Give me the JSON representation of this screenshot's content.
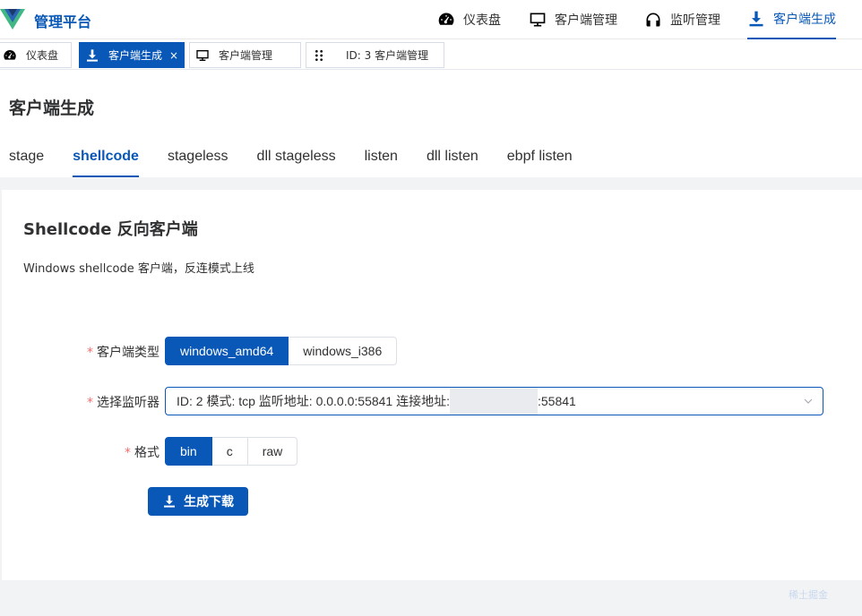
{
  "app": {
    "brand": "管理平台",
    "accent": "#0958b8"
  },
  "nav": {
    "items": [
      {
        "label": "仪表盘",
        "icon": "dashboard-icon"
      },
      {
        "label": "客户端管理",
        "icon": "monitor-icon"
      },
      {
        "label": "监听管理",
        "icon": "headphones-icon"
      },
      {
        "label": "客户端生成",
        "icon": "download-icon",
        "active": true
      }
    ]
  },
  "tabs": [
    {
      "label": "仪表盘",
      "icon": "dashboard-icon"
    },
    {
      "label": "客户端生成",
      "icon": "download-icon",
      "active": true,
      "close": "×"
    },
    {
      "label": "客户端管理",
      "icon": "monitor-icon"
    },
    {
      "label": "ID: 3 客户端管理",
      "icon": "grip-icon"
    }
  ],
  "page": {
    "title": "客户端生成",
    "sub_tabs": [
      "stage",
      "shellcode",
      "stageless",
      "dll stageless",
      "listen",
      "dll listen",
      "ebpf listen"
    ],
    "active_sub_tab": "shellcode"
  },
  "card": {
    "title": "Shellcode 反向客户端",
    "description": "Windows shellcode 客户端，反连模式上线"
  },
  "form": {
    "client_type": {
      "label": "客户端类型",
      "options": [
        "windows_amd64",
        "windows_i386"
      ],
      "selected": "windows_amd64"
    },
    "listener": {
      "label": "选择监听器",
      "value_prefix": "ID: 2 模式: tcp 监听地址: 0.0.0.0:55841 连接地址:",
      "value_suffix": ":55841"
    },
    "format": {
      "label": "格式",
      "options": [
        "bin",
        "c",
        "raw"
      ],
      "selected": "bin"
    },
    "required_mark": "*",
    "submit_label": "生成下载"
  },
  "watermark": "稀土掘金"
}
